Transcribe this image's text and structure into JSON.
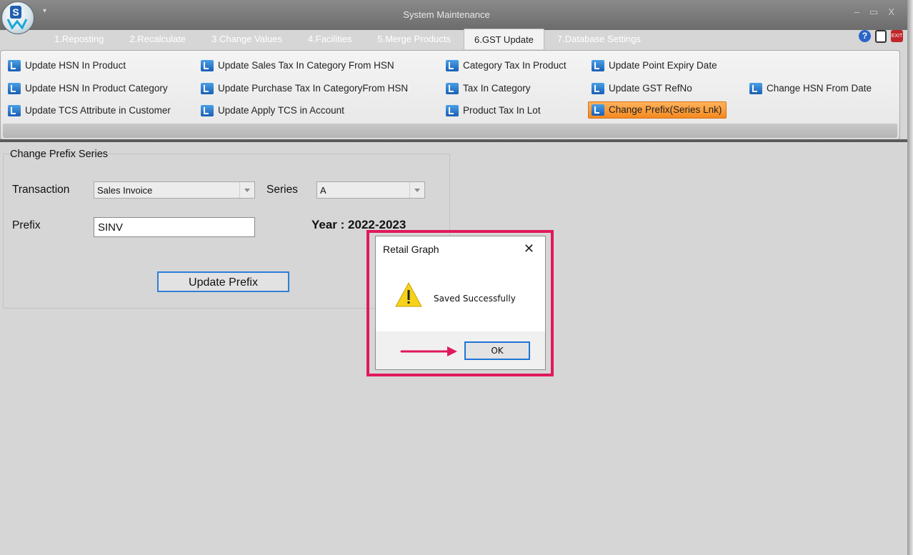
{
  "window": {
    "title": "System Maintenance",
    "controls": [
      "–",
      "▭",
      "X"
    ],
    "qat_glyph": "▾"
  },
  "logo": {
    "letter": "S"
  },
  "tabs": [
    {
      "label": "1.Reposting"
    },
    {
      "label": "2.Recalculate"
    },
    {
      "label": "3.Change Values"
    },
    {
      "label": "4.Facilities"
    },
    {
      "label": "5.Merge Products"
    },
    {
      "label": "6.GST Update",
      "active": true
    },
    {
      "label": "7.Database Settings"
    }
  ],
  "top_icons": {
    "help": "?",
    "exit": "EXIT"
  },
  "ribbon": {
    "items": [
      {
        "label": "Update HSN In Product",
        "icon": "update-icon"
      },
      {
        "label": "Update HSN In Product Category",
        "icon": "update-icon"
      },
      {
        "label": "Update TCS Attribute in Customer",
        "icon": "update-icon"
      },
      {
        "label": "Update Sales Tax In Category From HSN",
        "icon": "update-icon"
      },
      {
        "label": "Update Purchase Tax In CategoryFrom HSN",
        "icon": "update-icon"
      },
      {
        "label": "Update Apply TCS in Account",
        "icon": "update-icon"
      },
      {
        "label": "Category Tax In Product",
        "icon": "tax-icon"
      },
      {
        "label": "Tax In Category",
        "icon": "tax-icon"
      },
      {
        "label": "Product Tax In Lot",
        "icon": "tax-icon"
      },
      {
        "label": "Update Point Expiry Date",
        "icon": "update-icon"
      },
      {
        "label": "Update GST RefNo",
        "icon": "update-icon"
      },
      {
        "label": "Change Prefix(Series Lnk)",
        "icon": "prefix-icon",
        "active": true
      },
      {
        "label": "Change HSN From Date",
        "icon": "update-icon"
      }
    ]
  },
  "form": {
    "group_title": "Change Prefix Series",
    "transaction_label": "Transaction",
    "transaction_value": "Sales Invoice",
    "series_label": "Series",
    "series_value": "A",
    "prefix_label": "Prefix",
    "prefix_value": "SINV",
    "year_text": "Year : 2022-2023",
    "update_button": "Update Prefix"
  },
  "dialog": {
    "title": "Retail Graph",
    "close": "✕",
    "icon": "warning-icon",
    "message": "Saved Successfully",
    "ok_label": "OK"
  },
  "colors": {
    "highlight": "#e0195a",
    "active_ribbon": "#f48a1f",
    "focus_blue": "#1f75d8"
  }
}
